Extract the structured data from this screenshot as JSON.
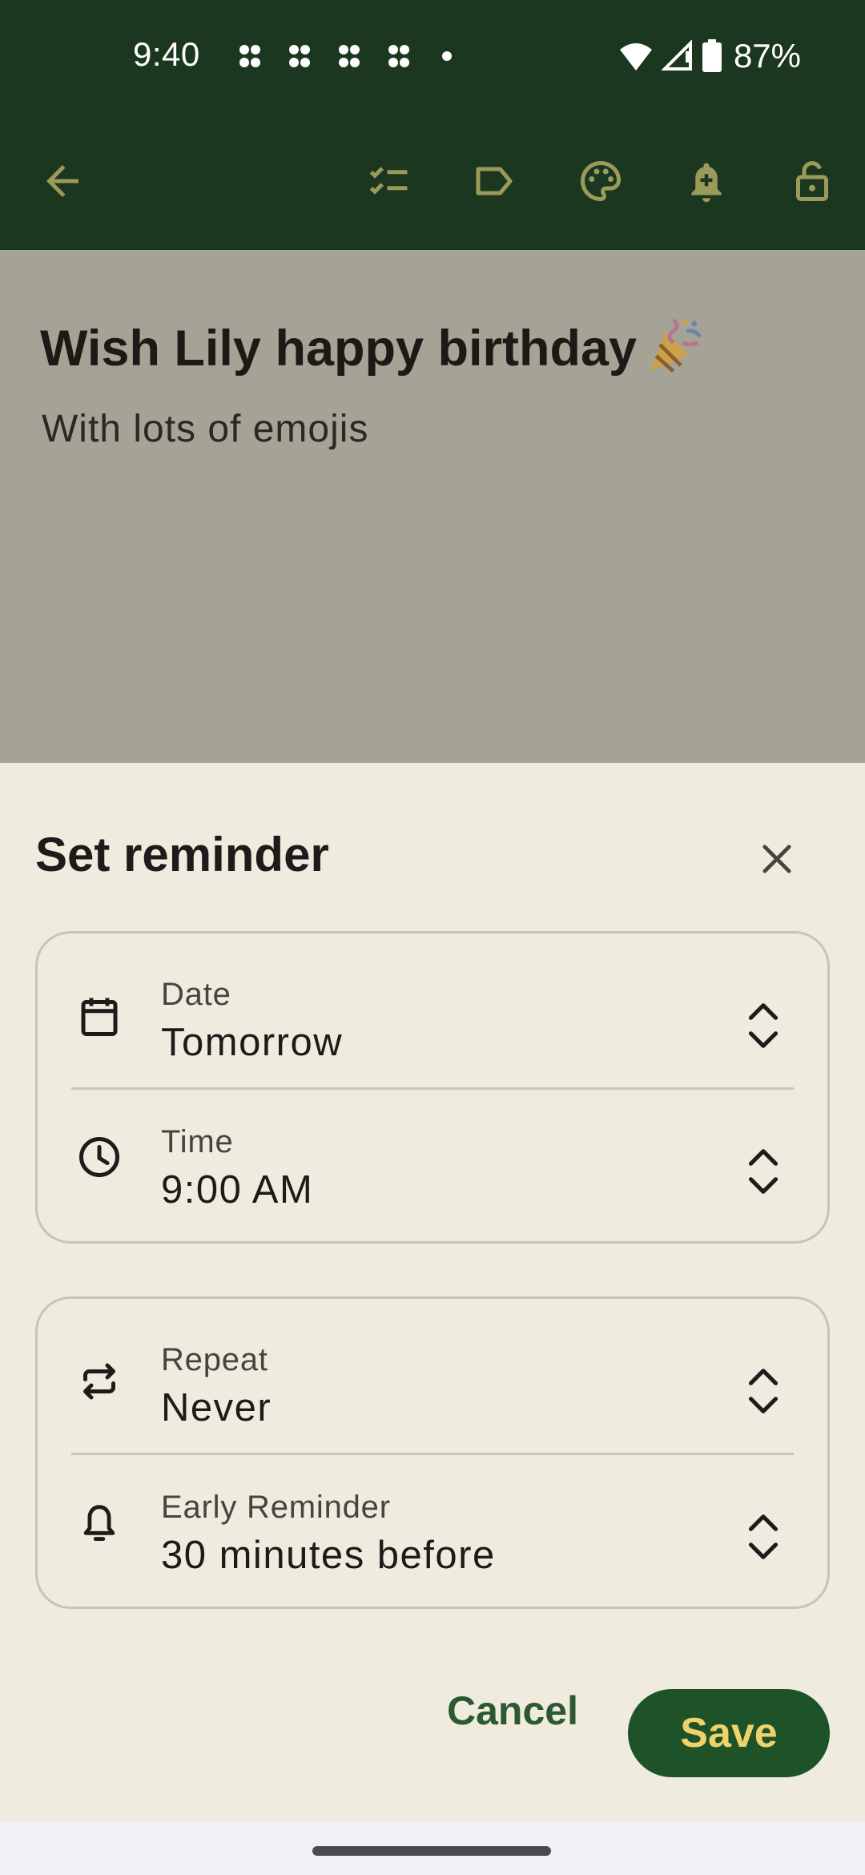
{
  "status_bar": {
    "time": "9:40",
    "battery_percent": "87%",
    "notification_icons": [
      "app-notification-icon",
      "app-notification-icon",
      "app-notification-icon",
      "app-notification-icon"
    ],
    "system_icons": [
      "wifi-icon",
      "cell-signal-icon",
      "battery-icon"
    ]
  },
  "toolbar": {
    "icons": [
      "back-arrow-icon",
      "checklist-icon",
      "label-icon",
      "palette-icon",
      "add-reminder-icon",
      "unlock-icon"
    ],
    "background_color": "#1c3720",
    "icon_color": "#9a9a5a"
  },
  "note": {
    "title": "Wish Lily happy birthday",
    "title_emoji": "party-popper-icon",
    "body": "With lots of emojis"
  },
  "reminder_sheet": {
    "title": "Set reminder",
    "date": {
      "label": "Date",
      "value": "Tomorrow"
    },
    "time": {
      "label": "Time",
      "value": "9:00 AM"
    },
    "repeat": {
      "label": "Repeat",
      "value": "Never"
    },
    "early_reminder": {
      "label": "Early Reminder",
      "value": "30 minutes before"
    },
    "cancel_label": "Cancel",
    "save_label": "Save",
    "accent_color": "#1e5228",
    "save_text_color": "#efd36a"
  }
}
